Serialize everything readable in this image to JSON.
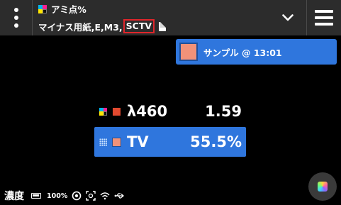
{
  "header": {
    "title": "アミ点%",
    "subtitle_prefix": "マイナス用紙,E,M3,",
    "subtitle_highlight": "SCTV",
    "menu_icon": "kebab-menu-icon",
    "dropdown_icon": "chevron-down-icon",
    "hamburger_icon": "hamburger-menu-icon",
    "highlight_color": "#e0262b"
  },
  "sample": {
    "label": "サンプル @ 13:01",
    "swatch_color": "#f19279"
  },
  "measurements": [
    {
      "label": "λ460",
      "value": "1.59",
      "swatch_color": "#e2492f"
    },
    {
      "label": "TV",
      "value": "55.5%",
      "swatch_color": "#f19279"
    }
  ],
  "status": {
    "mode": "濃度",
    "battery": "100%"
  },
  "colors": {
    "accent": "#2f76dd",
    "header_bg": "#2c2c2c",
    "background": "#000000"
  }
}
